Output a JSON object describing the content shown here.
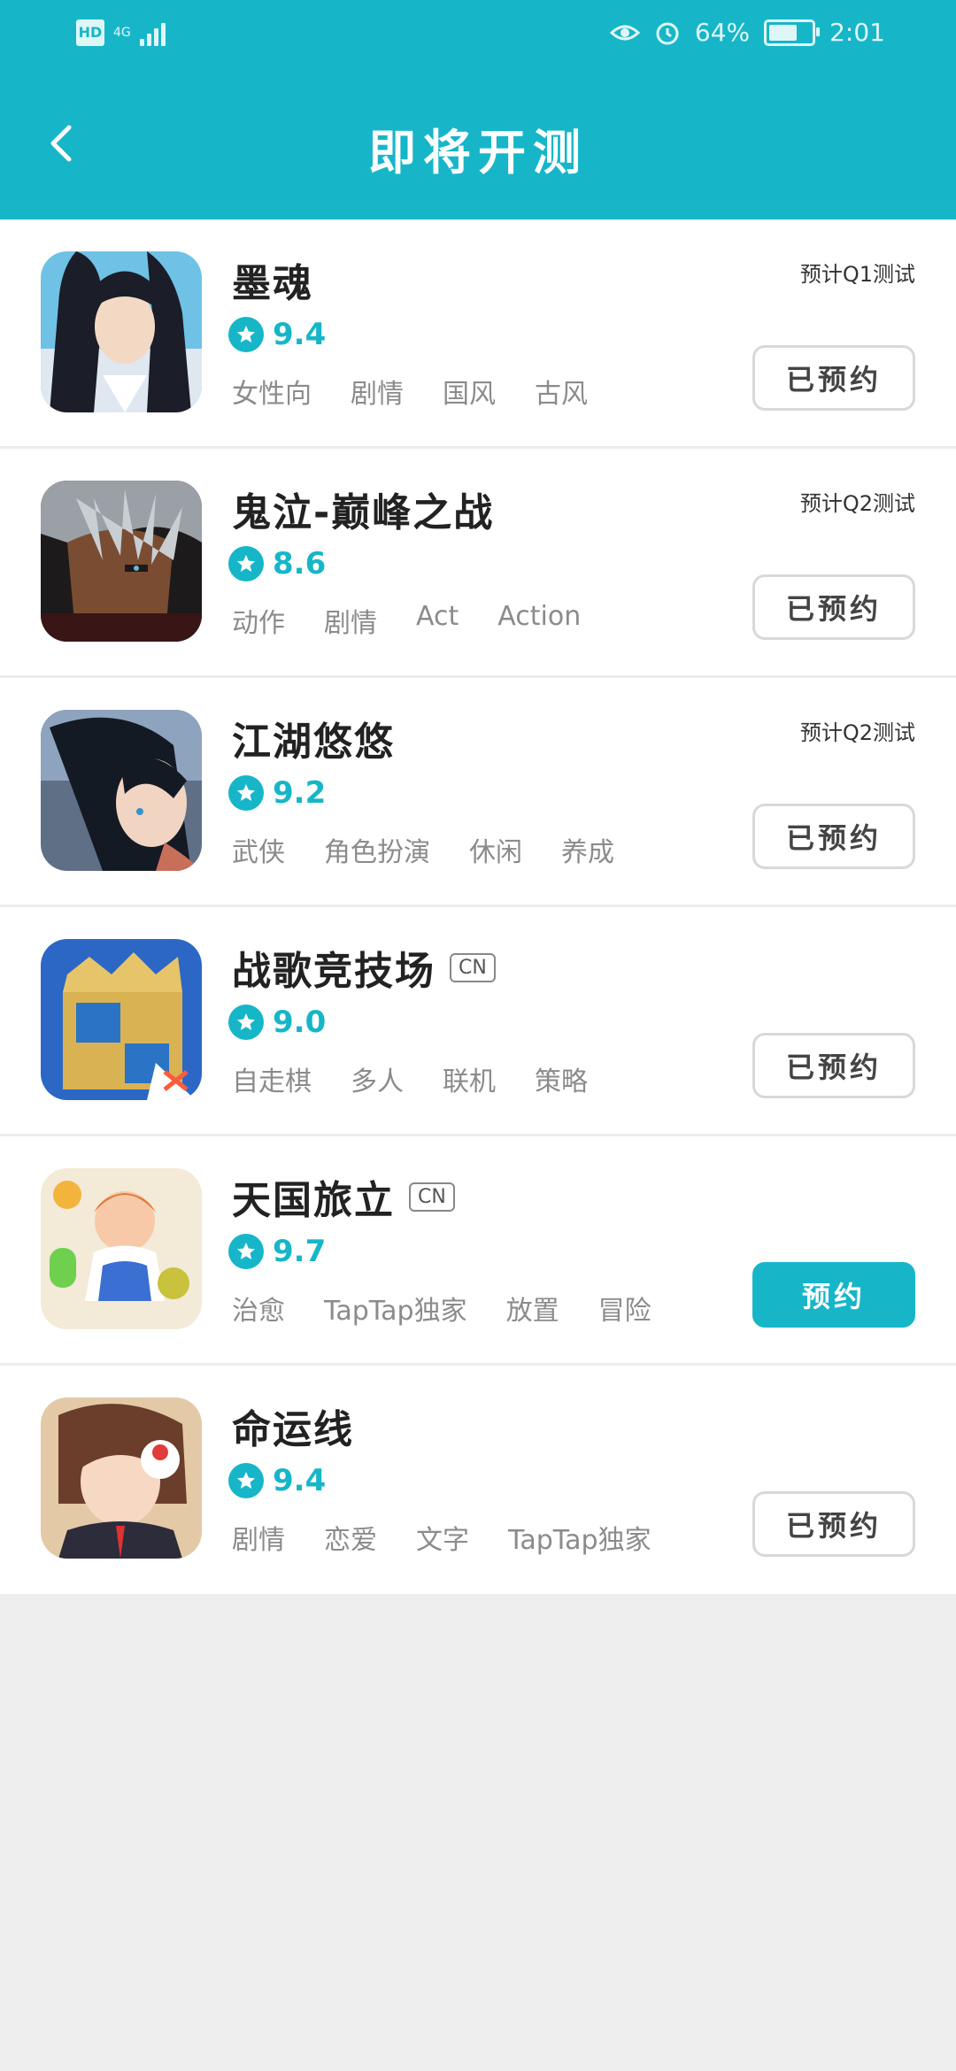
{
  "status": {
    "left_badge": "HD",
    "network": "4G",
    "battery": "64%",
    "time": "2:01"
  },
  "header": {
    "title": "即将开测"
  },
  "games": [
    {
      "name": "墨魂",
      "score": "9.4",
      "tags": [
        "女性向",
        "剧情",
        "国风",
        "古风"
      ],
      "note": "预计Q1测试",
      "button": "已预约",
      "primary": false,
      "cn_badge": ""
    },
    {
      "name": "鬼泣-巅峰之战",
      "score": "8.6",
      "tags": [
        "动作",
        "剧情",
        "Act",
        "Action"
      ],
      "note": "预计Q2测试",
      "button": "已预约",
      "primary": false,
      "cn_badge": ""
    },
    {
      "name": "江湖悠悠",
      "score": "9.2",
      "tags": [
        "武侠",
        "角色扮演",
        "休闲",
        "养成"
      ],
      "note": "预计Q2测试",
      "button": "已预约",
      "primary": false,
      "cn_badge": ""
    },
    {
      "name": "战歌竞技场",
      "score": "9.0",
      "tags": [
        "自走棋",
        "多人",
        "联机",
        "策略"
      ],
      "note": "",
      "button": "已预约",
      "primary": false,
      "cn_badge": "CN"
    },
    {
      "name": "天国旅立",
      "score": "9.7",
      "tags": [
        "治愈",
        "TapTap独家",
        "放置",
        "冒险"
      ],
      "note": "",
      "button": "预约",
      "primary": true,
      "cn_badge": "CN"
    },
    {
      "name": "命运线",
      "score": "9.4",
      "tags": [
        "剧情",
        "恋爱",
        "文字",
        "TapTap独家"
      ],
      "note": "",
      "button": "已预约",
      "primary": false,
      "cn_badge": ""
    }
  ],
  "colors": {
    "accent": "#16b6c8",
    "background": "#eeeeee"
  }
}
